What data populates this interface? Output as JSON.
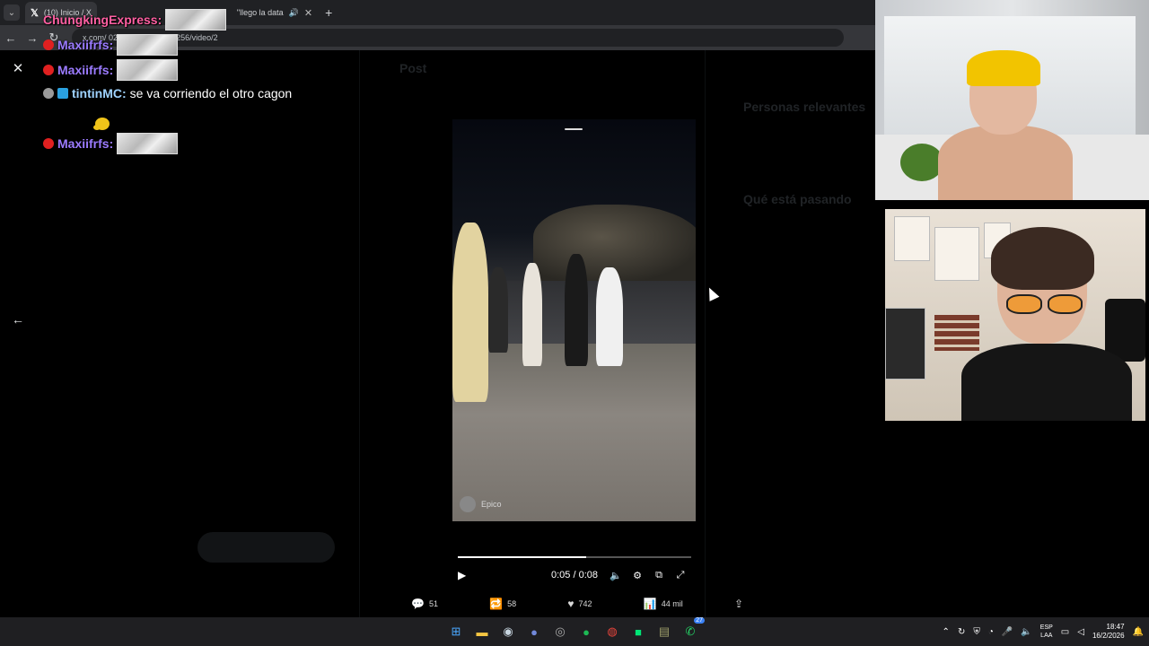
{
  "browser": {
    "tabs": [
      {
        "label": "(10) Inicio / X"
      },
      {
        "label": "\"llego la data"
      }
    ],
    "url": "x.com/           023252590419497256/video/2"
  },
  "x_background": {
    "header": "Post",
    "sidebar_right_title": "Personas relevantes",
    "sidebar_right_section": "Qué está pasando"
  },
  "video": {
    "watermark": "Epico",
    "current_time": "0:05",
    "duration": "0:08",
    "progress_fraction": 0.55
  },
  "post_actions": {
    "replies": "51",
    "reposts": "58",
    "likes": "742",
    "views": "44 mil"
  },
  "chat": [
    {
      "user": "ChungkingExpress:",
      "color": "#ff5fa2",
      "emote": true,
      "text": ""
    },
    {
      "user": "Maxiifrfs:",
      "color": "#9b7bff",
      "emote": true,
      "text": ""
    },
    {
      "user": "Maxiifrfs:",
      "color": "#9b7bff",
      "emote": true,
      "text": ""
    },
    {
      "user": "tintinMC:",
      "color": "#9fd3ff",
      "emote": false,
      "text": "se va corriendo el otro cagon"
    },
    {
      "user": "Maxiifrfs:",
      "color": "#9b7bff",
      "emote": true,
      "text": ""
    }
  ],
  "taskbar": {
    "lang_top": "ESP",
    "lang_bottom": "LAA",
    "time": "18:47",
    "date": "16/2/2026",
    "whatsapp_badge": "27"
  },
  "icons": {
    "close": "close-icon",
    "back": "arrow-left-icon",
    "play": "play-icon",
    "volume": "volume-icon",
    "settings": "gear-icon",
    "fullscreen": "fullscreen-icon"
  }
}
